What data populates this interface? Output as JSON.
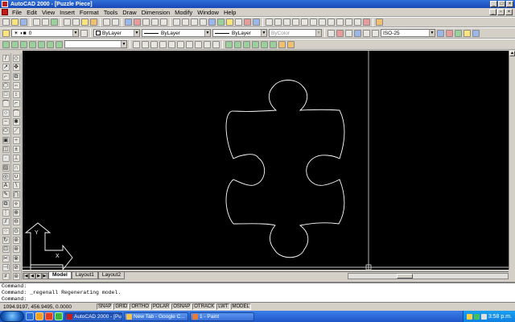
{
  "window": {
    "title": "AutoCAD 2000 - [Puzzle Piece]"
  },
  "menu": [
    "File",
    "Edit",
    "View",
    "Insert",
    "Format",
    "Tools",
    "Draw",
    "Dimension",
    "Modify",
    "Window",
    "Help"
  ],
  "properties": {
    "layer": "0",
    "color": "ByLayer",
    "linetype": "ByLayer",
    "lineweight": "ByLayer",
    "plotstyle": "ByColor",
    "dimstyle": "ISO-25"
  },
  "tabs": [
    "Model",
    "Layout1",
    "Layout2"
  ],
  "active_tab": "Model",
  "ucs": {
    "y_label": "Y",
    "x_label": "X"
  },
  "command_lines": [
    "Command:",
    "Command: _regenall Regenerating model.",
    "Command:"
  ],
  "status": {
    "coords": "1094.9197, 456.9495, 0.0000",
    "toggles": [
      "SNAP",
      "GRID",
      "ORTHO",
      "POLAR",
      "OSNAP",
      "OTRACK",
      "LWT",
      "MODEL"
    ]
  },
  "taskbar": {
    "tasks": [
      {
        "label": "AutoCAD 2000 - [Pu...",
        "color": "#c21c1c",
        "active": true
      },
      {
        "label": "New Tab - Google C...",
        "color": "#f2c14e",
        "active": false
      },
      {
        "label": "1 - Paint",
        "color": "#e87b3a",
        "active": false
      }
    ],
    "clock": "3:58 p.m."
  },
  "colors": {
    "canvas": "#000000",
    "geometry": "#ffffff",
    "titlebar": "#1f55c8",
    "ui": "#d4d0c8"
  }
}
